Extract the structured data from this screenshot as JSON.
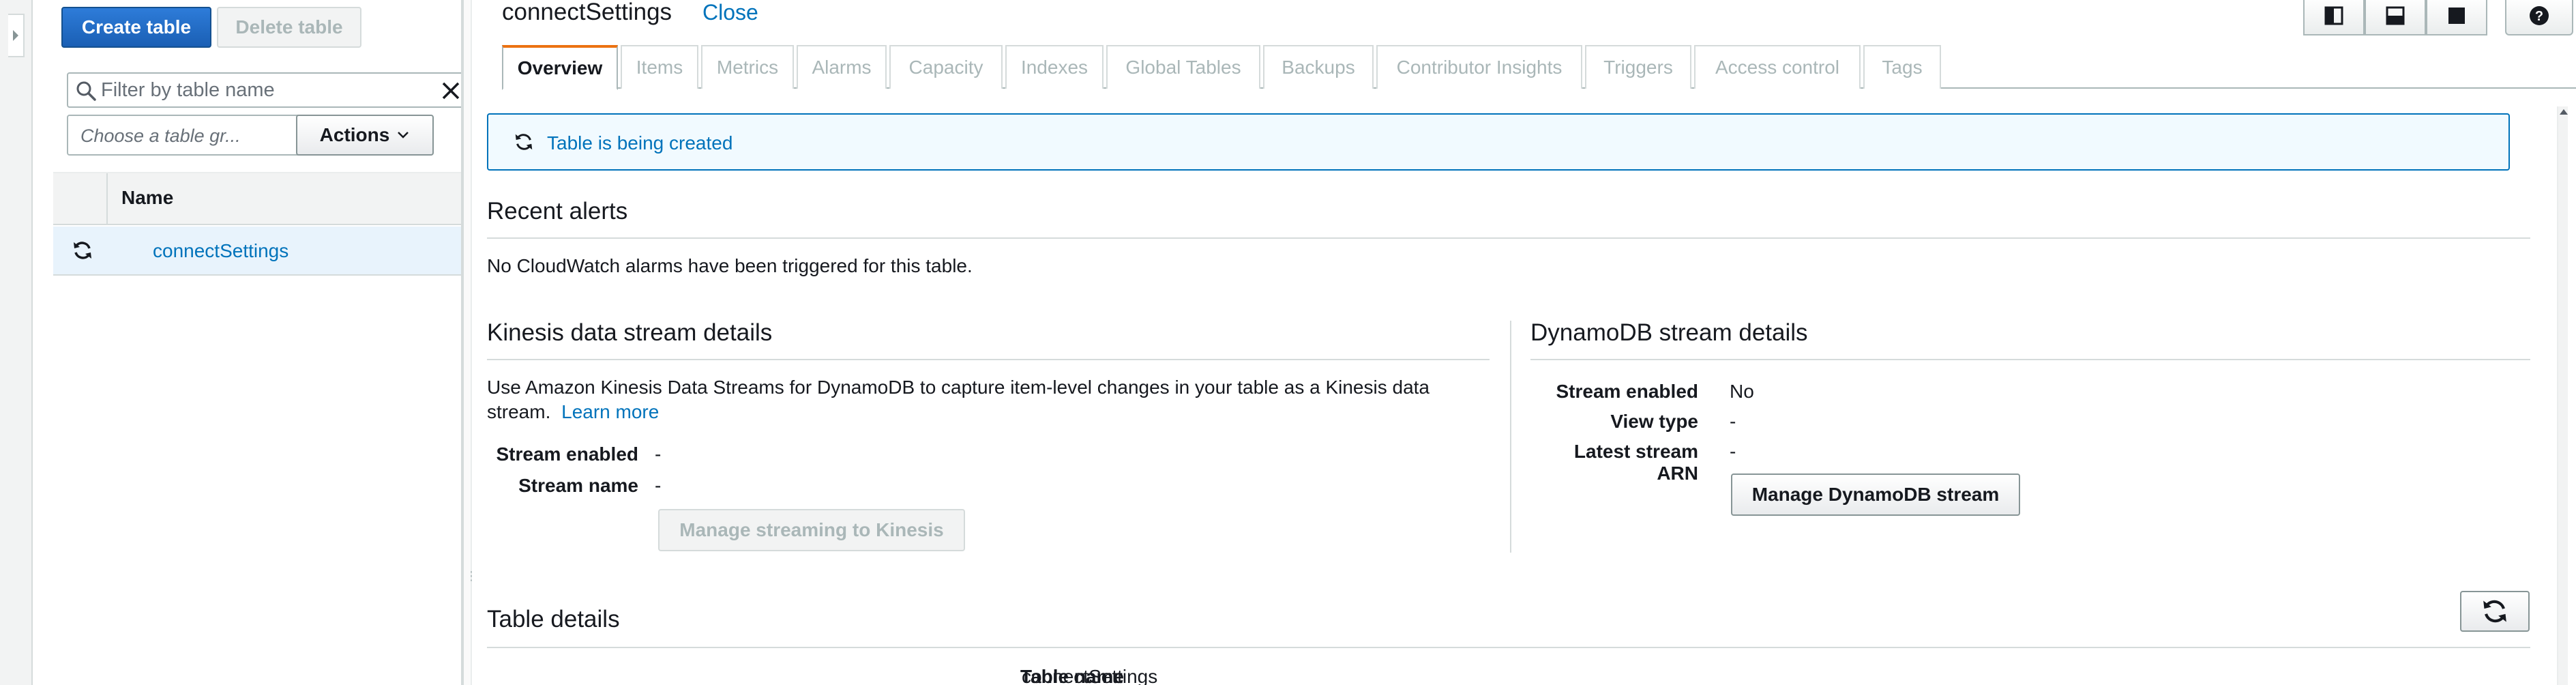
{
  "left": {
    "create_label": "Create table",
    "delete_label": "Delete table",
    "filter_placeholder": "Filter by table name",
    "group_placeholder": "Choose a table gr...",
    "actions_label": "Actions",
    "column_name": "Name",
    "rows": [
      {
        "name": "connectSettings"
      }
    ]
  },
  "main": {
    "title": "connectSettings",
    "close_label": "Close",
    "tabs": [
      {
        "label": "Overview",
        "active": true
      },
      {
        "label": "Items"
      },
      {
        "label": "Metrics"
      },
      {
        "label": "Alarms"
      },
      {
        "label": "Capacity"
      },
      {
        "label": "Indexes"
      },
      {
        "label": "Global Tables"
      },
      {
        "label": "Backups"
      },
      {
        "label": "Contributor Insights"
      },
      {
        "label": "Triggers"
      },
      {
        "label": "Access control"
      },
      {
        "label": "Tags"
      }
    ],
    "alert_text": "Table is being created",
    "recent_alerts": {
      "title": "Recent alerts",
      "text": "No CloudWatch alarms have been triggered for this table."
    },
    "kinesis": {
      "title": "Kinesis data stream details",
      "desc_line1": "Use Amazon Kinesis Data Streams for DynamoDB to capture item-level changes in your table as a Kinesis data",
      "desc_line2": "stream.",
      "learn_more": "Learn more",
      "stream_enabled_label": "Stream enabled",
      "stream_enabled_value": "-",
      "stream_name_label": "Stream name",
      "stream_name_value": "-",
      "manage_label": "Manage streaming to Kinesis"
    },
    "dynamodb_stream": {
      "title": "DynamoDB stream details",
      "stream_enabled_label": "Stream enabled",
      "stream_enabled_value": "No",
      "view_type_label": "View type",
      "view_type_value": "-",
      "arn_label": "Latest stream ARN",
      "arn_value": "-",
      "manage_label": "Manage DynamoDB stream"
    },
    "table_details": {
      "title": "Table details",
      "table_name_label": "Table name",
      "table_name_value": "connectSettings"
    }
  },
  "colors": {
    "primary": "#1a5fb4",
    "link": "#0073bb",
    "tab_accent": "#ec7211",
    "alert_bg": "#f1faff"
  }
}
